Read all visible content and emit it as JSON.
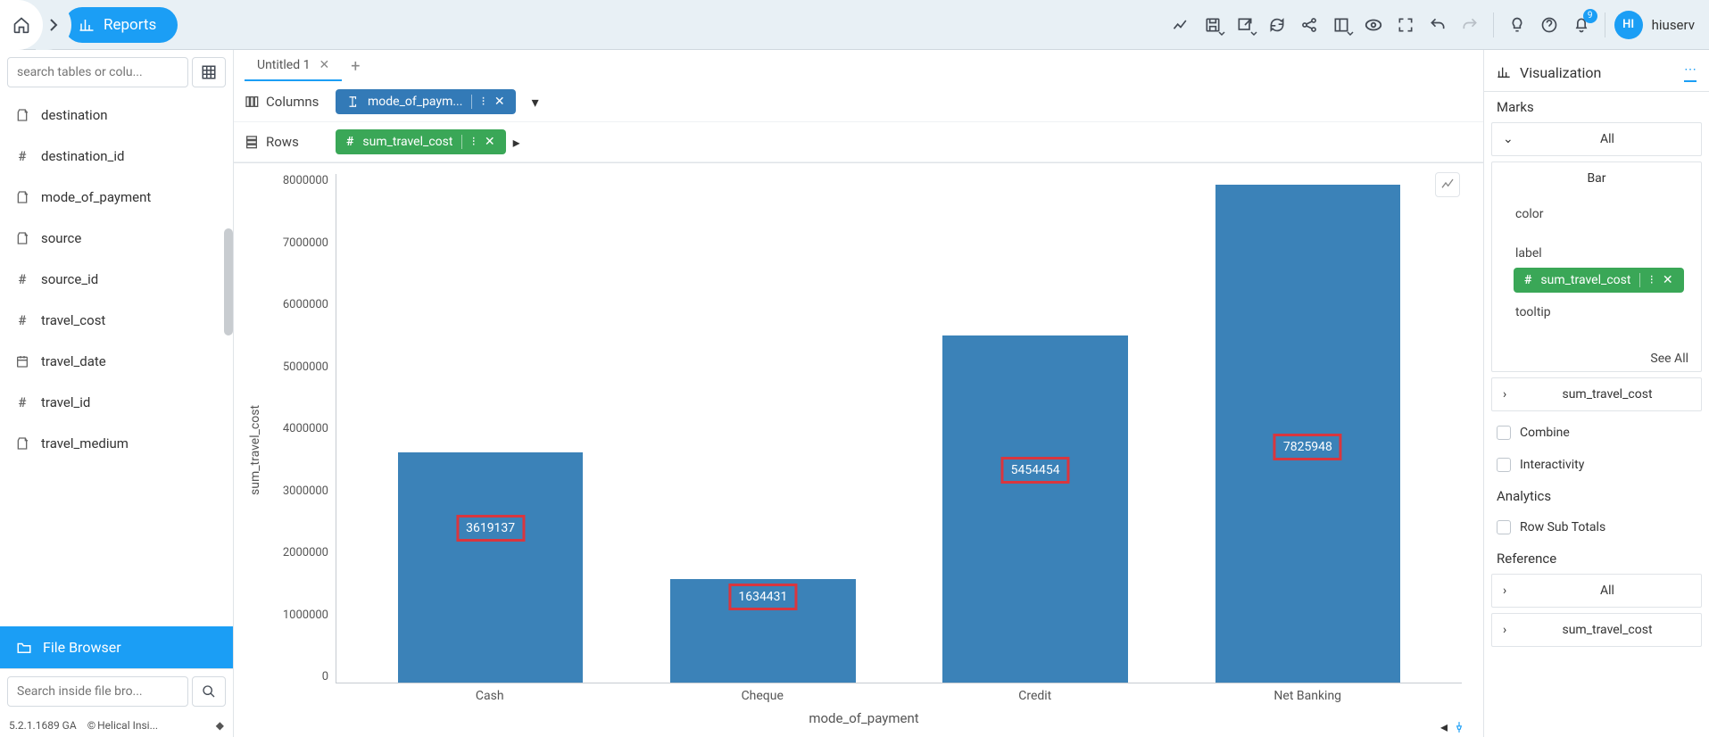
{
  "header": {
    "reports_label": "Reports",
    "user_name": "hiuserv",
    "avatar_initials": "HI",
    "notification_count": "9"
  },
  "sidebar": {
    "search_placeholder": "search tables or colu...",
    "fields": [
      {
        "icon": "text",
        "label": "destination"
      },
      {
        "icon": "hash",
        "label": "destination_id"
      },
      {
        "icon": "text",
        "label": "mode_of_payment"
      },
      {
        "icon": "text",
        "label": "source"
      },
      {
        "icon": "hash",
        "label": "source_id"
      },
      {
        "icon": "hash",
        "label": "travel_cost"
      },
      {
        "icon": "date",
        "label": "travel_date"
      },
      {
        "icon": "hash",
        "label": "travel_id"
      },
      {
        "icon": "text",
        "label": "travel_medium"
      }
    ],
    "file_browser_label": "File Browser",
    "file_search_placeholder": "Search inside file bro...",
    "version": "5.2.1.1689 GA",
    "copyright": "Helical Insi..."
  },
  "workspace": {
    "tab_title": "Untitled 1",
    "columns_label": "Columns",
    "rows_label": "Rows",
    "column_pill": "mode_of_paym...",
    "row_pill": "sum_travel_cost"
  },
  "chart_data": {
    "type": "bar",
    "categories": [
      "Cash",
      "Cheque",
      "Credit",
      "Net Banking"
    ],
    "values": [
      3619137,
      1634431,
      5454454,
      7825948
    ],
    "labels": [
      "3619137",
      "1634431",
      "5454454",
      "7825948"
    ],
    "xlabel": "mode_of_payment",
    "ylabel": "sum_travel_cost",
    "ylim": [
      0,
      8000000
    ],
    "y_ticks": [
      "8000000",
      "7000000",
      "6000000",
      "5000000",
      "4000000",
      "3000000",
      "2000000",
      "1000000",
      "0"
    ]
  },
  "rightpanel": {
    "title": "Visualization",
    "marks_label": "Marks",
    "all_label": "All",
    "bar_label": "Bar",
    "color_label": "color",
    "label_label": "label",
    "label_pill": "sum_travel_cost",
    "tooltip_label": "tooltip",
    "see_all": "See All",
    "sum_row": "sum_travel_cost",
    "combine": "Combine",
    "interactivity": "Interactivity",
    "analytics": "Analytics",
    "row_subtotals": "Row Sub Totals",
    "reference": "Reference",
    "ref_all": "All",
    "ref_sum": "sum_travel_cost"
  }
}
